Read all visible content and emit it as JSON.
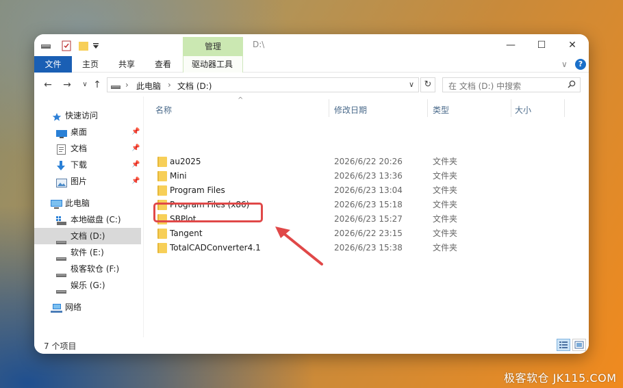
{
  "title_bar": {
    "manage_tab": "管理",
    "path": "D:\\"
  },
  "window_buttons": {
    "minimize": "—",
    "maximize": "☐",
    "close": "✕"
  },
  "ribbon": {
    "tabs": [
      "文件",
      "主页",
      "共享",
      "查看",
      "驱动器工具"
    ],
    "expand": "∨",
    "help": "?"
  },
  "address": {
    "breadcrumbs": [
      "此电脑",
      "文档 (D:)"
    ],
    "separator": "›",
    "refresh": "↻",
    "dropdown": "∨",
    "search_placeholder": "在 文档 (D:) 中搜索"
  },
  "sidebar": {
    "items": [
      {
        "label": "快速访问",
        "icon": "star-icon",
        "pinned": false
      },
      {
        "label": "桌面",
        "icon": "desktop-icon",
        "pinned": true
      },
      {
        "label": "文档",
        "icon": "document-icon",
        "pinned": true
      },
      {
        "label": "下载",
        "icon": "download-icon",
        "pinned": true
      },
      {
        "label": "图片",
        "icon": "picture-icon",
        "pinned": true
      },
      {
        "label": "此电脑",
        "icon": "computer-icon",
        "pinned": false
      },
      {
        "label": "本地磁盘 (C:)",
        "icon": "system-drive-icon",
        "pinned": false
      },
      {
        "label": "文档 (D:)",
        "icon": "drive-icon",
        "pinned": false,
        "selected": true
      },
      {
        "label": "软件 (E:)",
        "icon": "drive-icon",
        "pinned": false
      },
      {
        "label": "极客软仓 (F:)",
        "icon": "drive-icon",
        "pinned": false
      },
      {
        "label": "娱乐 (G:)",
        "icon": "drive-icon",
        "pinned": false
      },
      {
        "label": "网络",
        "icon": "network-icon",
        "pinned": false
      }
    ]
  },
  "columns": {
    "name": "名称",
    "date": "修改日期",
    "type": "类型",
    "size": "大小"
  },
  "files": [
    {
      "name": "au2025",
      "date": "2026/6/22 20:26",
      "type": "文件夹"
    },
    {
      "name": "Mini",
      "date": "2026/6/23 13:36",
      "type": "文件夹"
    },
    {
      "name": "Program Files",
      "date": "2026/6/23 13:04",
      "type": "文件夹"
    },
    {
      "name": "Program Files (x86)",
      "date": "2026/6/23 15:18",
      "type": "文件夹"
    },
    {
      "name": "SBPlot",
      "date": "2026/6/23 15:27",
      "type": "文件夹"
    },
    {
      "name": "Tangent",
      "date": "2026/6/22 23:15",
      "type": "文件夹"
    },
    {
      "name": "TotalCADConverter4.1",
      "date": "2026/6/23 15:38",
      "type": "文件夹"
    }
  ],
  "status": {
    "count": "7 个项目"
  },
  "watermark": "极客软仓 JK115.COM",
  "colors": {
    "accent": "#1a5fb4",
    "manage_tab": "#cbe8b2",
    "highlight": "#e04848",
    "folder": "#f7cf58"
  }
}
